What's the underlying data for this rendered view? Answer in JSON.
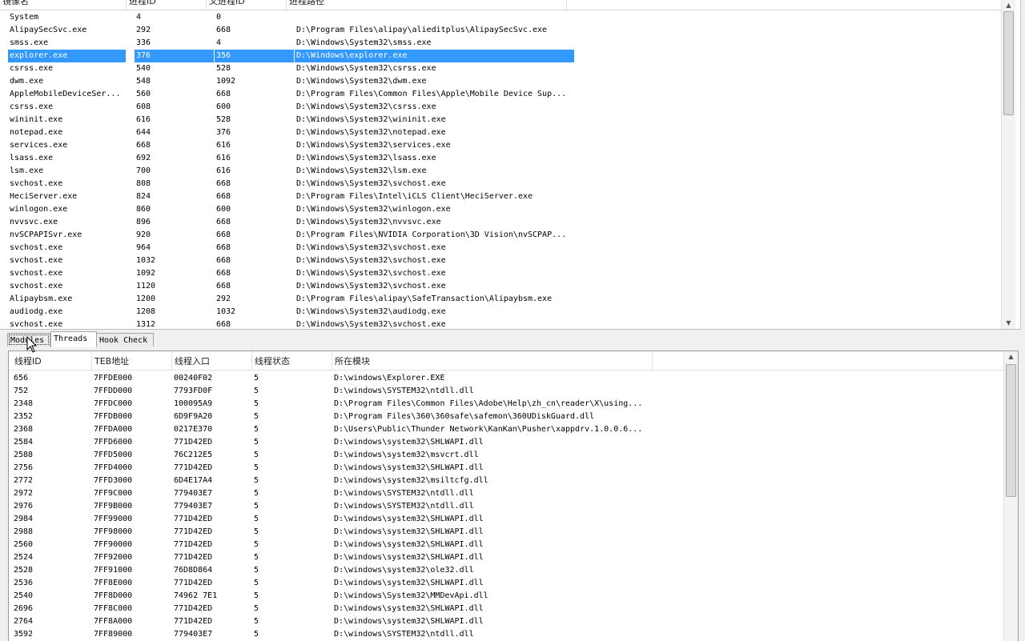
{
  "process_list": {
    "columns": [
      "镜像名",
      "进程ID",
      "父进程ID",
      "进程路径"
    ],
    "selected_index": 3,
    "rows": [
      [
        "System",
        "4",
        "0",
        ""
      ],
      [
        "AlipaySecSvc.exe",
        "292",
        "668",
        "D:\\Program Files\\alipay\\alieditplus\\AlipaySecSvc.exe"
      ],
      [
        "smss.exe",
        "336",
        "4",
        "D:\\Windows\\System32\\smss.exe"
      ],
      [
        "explorer.exe",
        "376",
        "356",
        "D:\\Windows\\explorer.exe"
      ],
      [
        "csrss.exe",
        "540",
        "528",
        "D:\\Windows\\System32\\csrss.exe"
      ],
      [
        "dwm.exe",
        "548",
        "1092",
        "D:\\Windows\\System32\\dwm.exe"
      ],
      [
        "AppleMobileDeviceSer...",
        "560",
        "668",
        "D:\\Program Files\\Common Files\\Apple\\Mobile Device Sup..."
      ],
      [
        "csrss.exe",
        "608",
        "600",
        "D:\\Windows\\System32\\csrss.exe"
      ],
      [
        "wininit.exe",
        "616",
        "528",
        "D:\\Windows\\System32\\wininit.exe"
      ],
      [
        "notepad.exe",
        "644",
        "376",
        "D:\\Windows\\System32\\notepad.exe"
      ],
      [
        "services.exe",
        "668",
        "616",
        "D:\\Windows\\System32\\services.exe"
      ],
      [
        "lsass.exe",
        "692",
        "616",
        "D:\\Windows\\System32\\lsass.exe"
      ],
      [
        "lsm.exe",
        "700",
        "616",
        "D:\\Windows\\System32\\lsm.exe"
      ],
      [
        "svchost.exe",
        "808",
        "668",
        "D:\\Windows\\System32\\svchost.exe"
      ],
      [
        "HeciServer.exe",
        "824",
        "668",
        "D:\\Program Files\\Intel\\iCLS Client\\HeciServer.exe"
      ],
      [
        "winlogon.exe",
        "860",
        "600",
        "D:\\Windows\\System32\\winlogon.exe"
      ],
      [
        "nvvsvc.exe",
        "896",
        "668",
        "D:\\Windows\\System32\\nvvsvc.exe"
      ],
      [
        "nvSCPAPISvr.exe",
        "920",
        "668",
        "D:\\Program Files\\NVIDIA Corporation\\3D Vision\\nvSCPAP..."
      ],
      [
        "svchost.exe",
        "964",
        "668",
        "D:\\Windows\\System32\\svchost.exe"
      ],
      [
        "svchost.exe",
        "1032",
        "668",
        "D:\\Windows\\System32\\svchost.exe"
      ],
      [
        "svchost.exe",
        "1092",
        "668",
        "D:\\Windows\\System32\\svchost.exe"
      ],
      [
        "svchost.exe",
        "1120",
        "668",
        "D:\\Windows\\System32\\svchost.exe"
      ],
      [
        "Alipaybsm.exe",
        "1200",
        "292",
        "D:\\Program Files\\alipay\\SafeTransaction\\Alipaybsm.exe"
      ],
      [
        "audiodg.exe",
        "1208",
        "1032",
        "D:\\Windows\\System32\\audiodg.exe"
      ],
      [
        "svchost.exe",
        "1312",
        "668",
        "D:\\Windows\\System32\\svchost.exe"
      ]
    ]
  },
  "tabs": [
    {
      "label": "Modules",
      "active": false
    },
    {
      "label": "Threads",
      "active": true
    },
    {
      "label": "Hook Check",
      "active": false
    }
  ],
  "thread_list": {
    "columns": [
      "线程ID",
      "TEB地址",
      "线程入口",
      "线程状态",
      "所在模块"
    ],
    "rows": [
      [
        "656",
        "7FFDE000",
        "00240F02",
        "5",
        "D:\\windows\\Explorer.EXE"
      ],
      [
        "752",
        "7FFDD000",
        "7793FD0F",
        "5",
        "D:\\windows\\SYSTEM32\\ntdll.dll"
      ],
      [
        "2348",
        "7FFDC000",
        "100095A9",
        "5",
        "D:\\Program Files\\Common Files\\Adobe\\Help\\zh_cn\\reader\\X\\using..."
      ],
      [
        "2352",
        "7FFDB000",
        "6D9F9A20",
        "5",
        "D:\\Program Files\\360\\360safe\\safemon\\360UDiskGuard.dll"
      ],
      [
        "2368",
        "7FFDA000",
        "0217E370",
        "5",
        "D:\\Users\\Public\\Thunder Network\\KanKan\\Pusher\\xappdrv.1.0.0.6..."
      ],
      [
        "2584",
        "7FFD6000",
        "771D42ED",
        "5",
        "D:\\windows\\system32\\SHLWAPI.dll"
      ],
      [
        "2588",
        "7FFD5000",
        "76C212E5",
        "5",
        "D:\\windows\\system32\\msvcrt.dll"
      ],
      [
        "2756",
        "7FFD4000",
        "771D42ED",
        "5",
        "D:\\windows\\system32\\SHLWAPI.dll"
      ],
      [
        "2772",
        "7FFD3000",
        "6D4E17A4",
        "5",
        "D:\\windows\\system32\\msiltcfg.dll"
      ],
      [
        "2972",
        "7FF9C000",
        "779403E7",
        "5",
        "D:\\windows\\SYSTEM32\\ntdll.dll"
      ],
      [
        "2976",
        "7FF9B000",
        "779403E7",
        "5",
        "D:\\windows\\SYSTEM32\\ntdll.dll"
      ],
      [
        "2984",
        "7FF99000",
        "771D42ED",
        "5",
        "D:\\windows\\system32\\SHLWAPI.dll"
      ],
      [
        "2988",
        "7FF98000",
        "771D42ED",
        "5",
        "D:\\windows\\system32\\SHLWAPI.dll"
      ],
      [
        "2560",
        "7FF90000",
        "771D42ED",
        "5",
        "D:\\windows\\system32\\SHLWAPI.dll"
      ],
      [
        "2524",
        "7FF92000",
        "771D42ED",
        "5",
        "D:\\windows\\system32\\SHLWAPI.dll"
      ],
      [
        "2528",
        "7FF91000",
        "76D8D864",
        "5",
        "D:\\windows\\system32\\ole32.dll"
      ],
      [
        "2536",
        "7FF8E000",
        "771D42ED",
        "5",
        "D:\\windows\\system32\\SHLWAPI.dll"
      ],
      [
        "2540",
        "7FF8D000",
        "74962 7E1",
        "5",
        "D:\\windows\\System32\\MMDevApi.dll"
      ],
      [
        "2696",
        "7FF8C000",
        "771D42ED",
        "5",
        "D:\\windows\\system32\\SHLWAPI.dll"
      ],
      [
        "2764",
        "7FF8A000",
        "771D42ED",
        "5",
        "D:\\windows\\system32\\SHLWAPI.dll"
      ],
      [
        "3592",
        "7FF89000",
        "779403E7",
        "5",
        "D:\\windows\\SYSTEM32\\ntdll.dll"
      ]
    ]
  },
  "icons": {
    "scroll_up": "▲",
    "scroll_down": "▼",
    "grip": "≡"
  },
  "colors": {
    "selection": "#3399ff",
    "selection_text": "#ffffff"
  }
}
